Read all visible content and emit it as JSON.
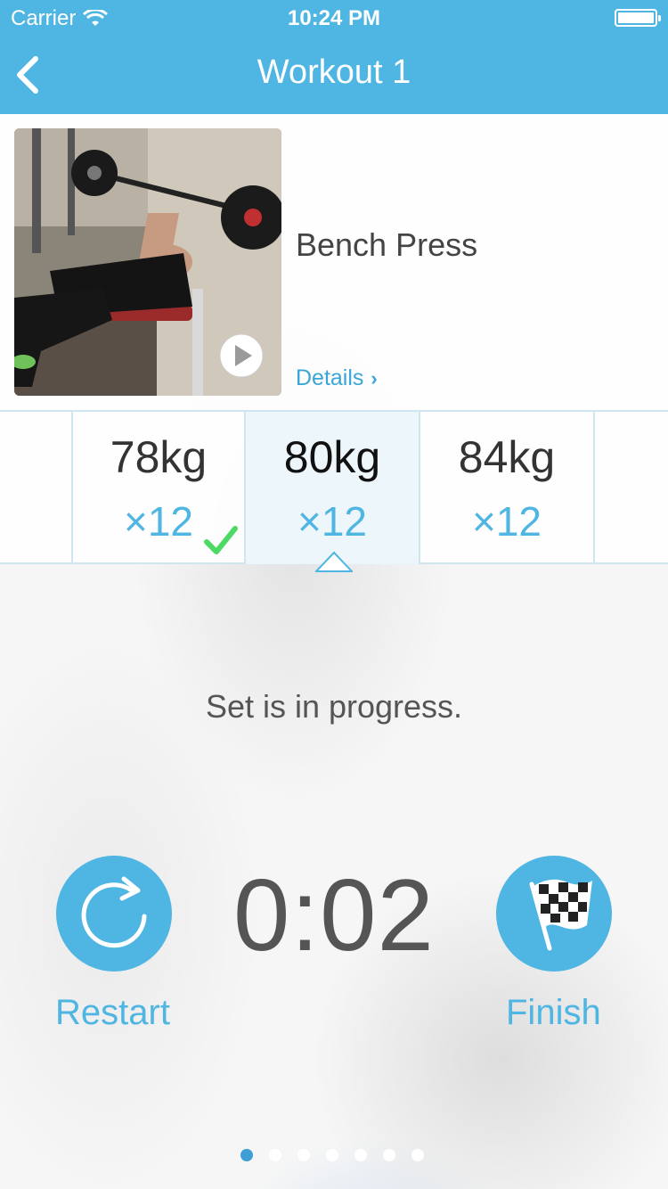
{
  "status_bar": {
    "carrier": "Carrier",
    "time": "10:24 PM"
  },
  "nav": {
    "title": "Workout 1",
    "back_icon": "chevron-left-icon"
  },
  "exercise": {
    "name": "Bench Press",
    "details_label": "Details",
    "details_icon": "chevron-right-icon",
    "thumbnail": "bench-press-photo",
    "play_icon": "play-icon"
  },
  "sets": [
    {
      "weight": "78kg",
      "reps": "×12",
      "done": true
    },
    {
      "weight": "80kg",
      "reps": "×12",
      "current": true
    },
    {
      "weight": "84kg",
      "reps": "×12"
    }
  ],
  "status_text": "Set is in progress.",
  "timer": "0:02",
  "controls": {
    "restart_label": "Restart",
    "restart_icon": "restart-icon",
    "finish_label": "Finish",
    "finish_icon": "checkered-flag-icon"
  },
  "pager": {
    "total": 7,
    "active_index": 0
  },
  "colors": {
    "accent": "#4fb5e2",
    "check": "#4cd964",
    "text": "#555555"
  }
}
